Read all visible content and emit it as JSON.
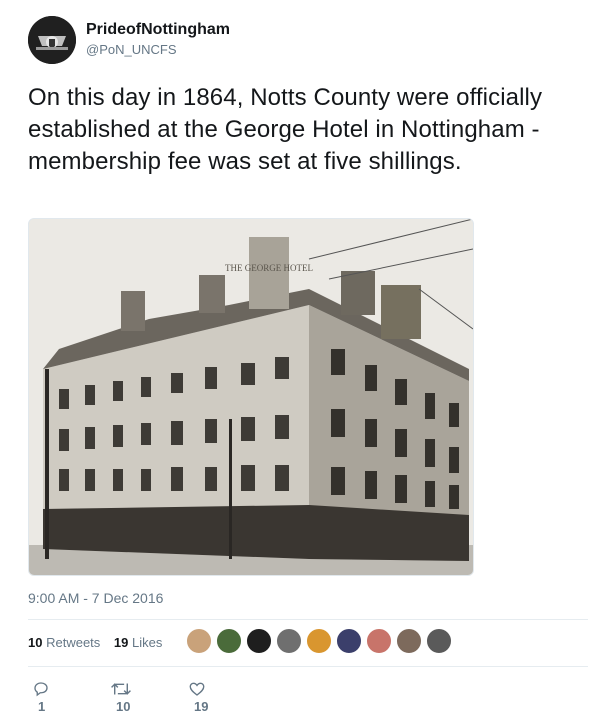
{
  "user": {
    "display_name": "PrideofNottingham",
    "handle": "@PoN_UNCFS"
  },
  "tweet": {
    "text": "On this day in 1864, Notts County were officially established at the George Hotel in Nottingham - membership fee was set at five shillings.",
    "photo_sign_text": "THE GEORGE HOTEL",
    "timestamp": "9:00 AM - 7 Dec 2016"
  },
  "stats": {
    "retweets_count": "10",
    "retweets_label": "Retweets",
    "likes_count": "19",
    "likes_label": "Likes"
  },
  "liker_avatars": [
    "#c9a27a",
    "#4a6b3a",
    "#1e1e1e",
    "#6f6f6f",
    "#d9962f",
    "#3b3f6b",
    "#c8746a",
    "#7d6a5c",
    "#5a5a5a"
  ],
  "actions": {
    "reply_count": "1",
    "retweet_count": "10",
    "like_count": "19"
  },
  "colors": {
    "text": "#14171a",
    "secondary": "#657786",
    "divider": "#e6ecf0"
  }
}
